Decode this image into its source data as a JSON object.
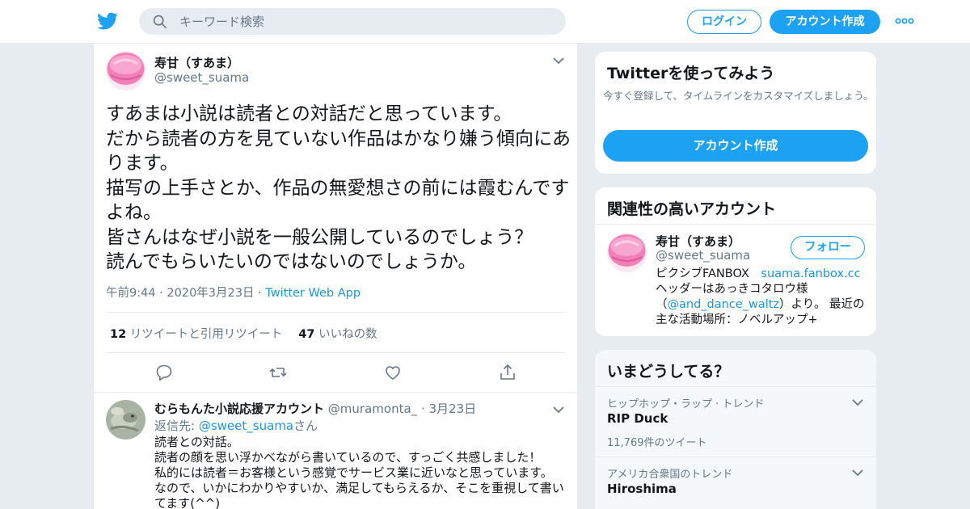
{
  "header": {
    "search_placeholder": "キーワード検索",
    "login_label": "ログイン",
    "signup_label": "アカウント作成"
  },
  "tweet": {
    "name": "寿甘（すあま）",
    "handle": "@sweet_suama",
    "text": "すあまは小説は読者との対話だと思っています。\nだから読者の方を見ていない作品はかなり嫌う傾向にあります。\n描写の上手さとか、作品の無愛想さの前には霞むんですよね。\n皆さんはなぜ小説を一般公開しているのでしょう？\n読んでもらいたいのではないのでしょうか。",
    "time": "午前9:44",
    "date": "2020年3月23日",
    "source": "Twitter Web App",
    "retweet_count": "12",
    "retweet_label": "リツイートと引用リツイート",
    "like_count": "47",
    "like_label": "いいねの数"
  },
  "reply": {
    "name": "むらもんた小説応援アカウント",
    "handle": "@muramonta_",
    "date": "3月23日",
    "to_prefix": "返信先: ",
    "to_mention": "@sweet_suama",
    "to_suffix": "さん",
    "text": "読者との対話。\n読者の顔を思い浮かべながら書いているので、すっごく共感しました！\n私的には読者＝お客様という感覚でサービス業に近いなと思っています。\nなので、いかにわかりやすいか、満足してもらえるか、そこを重視して書いてます(^^)"
  },
  "signup_card": {
    "title": "Twitterを使ってみよう",
    "subtitle": "今すぐ登録して、タイムラインをカスタマイズしましょう。",
    "button": "アカウント作成"
  },
  "related": {
    "title": "関連性の高いアカウント",
    "name": "寿甘（すあま）",
    "handle": "@sweet_suama",
    "follow_label": "フォロー",
    "bio_part1": "ピクシブFANBOX　",
    "bio_link1": "suama.fanbox.cc",
    "bio_part2": " ヘッダーはあっきコタロウ様（",
    "bio_link2": "@and_dance_waltz",
    "bio_part3": "）より。 最近の主な活動場所：ノベルアップ+"
  },
  "trends": {
    "title": "いまどうしてる？",
    "items": [
      {
        "context": "ヒップホップ・ラップ · トレンド",
        "name": "RIP Duck",
        "count": "11,769件のツイート"
      },
      {
        "context": "アメリカ合衆国のトレンド",
        "name": "Hiroshima",
        "count": ""
      }
    ]
  },
  "colors": {
    "accent": "#1da1f2",
    "link": "#1b95e0",
    "muted": "#657786"
  }
}
